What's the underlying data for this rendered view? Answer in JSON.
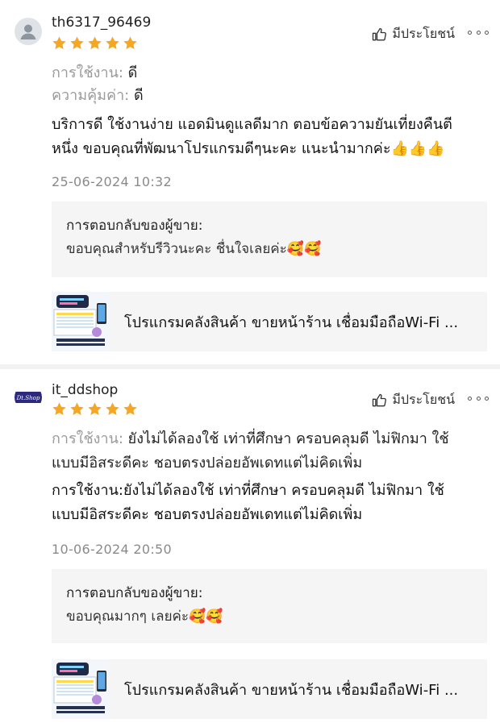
{
  "colors": {
    "star": "#f5a623",
    "reply_bg": "#f5f5f5",
    "muted": "#9a9a9a",
    "date": "#8a8a8a"
  },
  "reviews": [
    {
      "username": "th6317_96469",
      "avatar": "default-user-icon",
      "rating": 5,
      "helpful_label": "มีประโยชน์",
      "attributes": [
        {
          "key": "การใช้งาน:",
          "value": " ดี"
        },
        {
          "key": "ความคุ้มค่า:",
          "value": " ดี"
        }
      ],
      "body_lines": [
        "บริการดี ใช้งานง่าย แอดมินดูแลดีมาก ตอบข้อความยันเที่ยงคืนตี",
        "หนึ่ง ขอบคุณที่พัฒนาโปรแกรมดีๆนะคะ แนะนำมากค่ะ👍👍👍"
      ],
      "date": "25-06-2024 10:32",
      "reply_title": "การตอบกลับของผู้ขาย:",
      "reply_text": "ขอบคุณสำหรับรีวิวนะคะ ชื่นใจเลยค่ะ🥰🥰",
      "product_name": "โปรแกรมคลังสินค้า ขายหน้าร้าน เชื่อมมือถือWi-Fi ..."
    },
    {
      "username": "it_ddshop",
      "avatar": "brand-logo",
      "avatar_text": "Dt.Shop",
      "rating": 5,
      "helpful_label": "มีประโยชน์",
      "attributes": [
        {
          "key": "การใช้งาน:",
          "value": " ยังไม่ได้ลองใช้ เท่าที่ศึกษา ครอบคลุมดี ไม่ฟิกมา ใช้"
        }
      ],
      "attr_continuation": "แบบมีอิสระดีคะ ชอบตรงปล่อยอัพเดทแต่ไม่คิดเพิ่ม",
      "body_lines": [
        "การใช้งาน:ยังไม่ได้ลองใช้ เท่าที่ศึกษา ครอบคลุมดี ไม่ฟิกมา ใช้",
        "แบบมีอิสระดีคะ ชอบตรงปล่อยอัพเดทแต่ไม่คิดเพิ่ม"
      ],
      "date": "10-06-2024 20:50",
      "reply_title": "การตอบกลับของผู้ขาย:",
      "reply_text": "ขอบคุณมากๆ เลยค่ะ🥰🥰",
      "product_name": "โปรแกรมคลังสินค้า ขายหน้าร้าน เชื่อมมือถือWi-Fi ..."
    }
  ]
}
